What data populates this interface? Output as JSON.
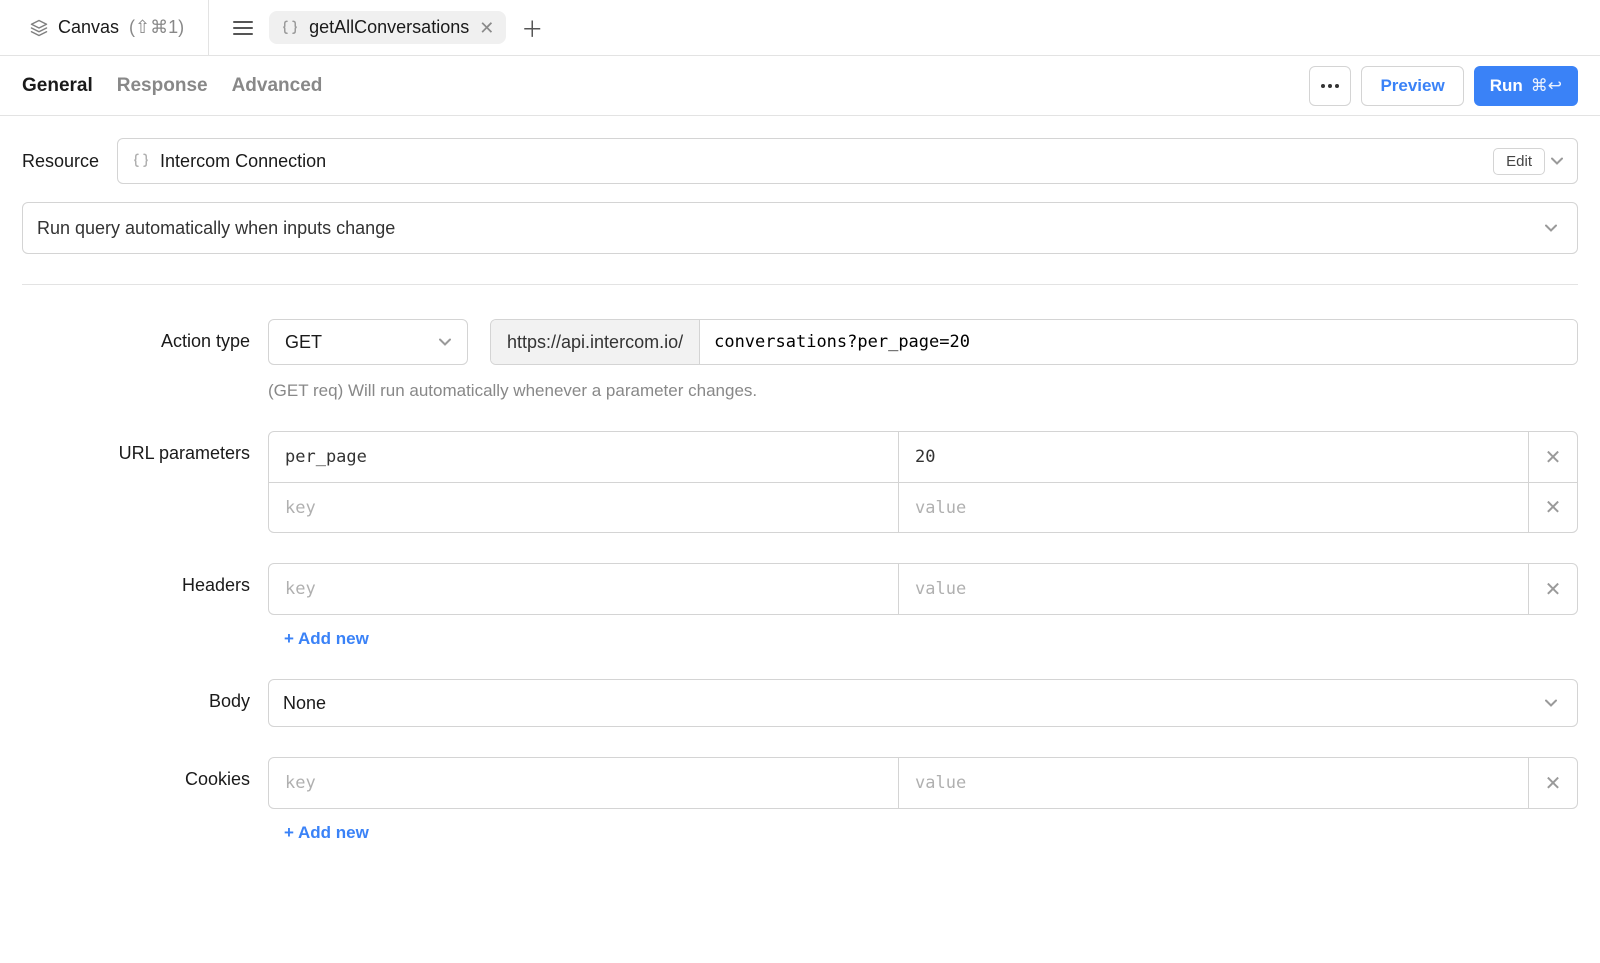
{
  "top": {
    "canvas_label": "Canvas",
    "canvas_shortcut": "(⇧⌘1)",
    "tab_name": "getAllConversations"
  },
  "view_tabs": {
    "general": "General",
    "response": "Response",
    "advanced": "Advanced"
  },
  "actions": {
    "preview": "Preview",
    "run": "Run",
    "run_shortcut": "⌘↩"
  },
  "resource": {
    "label": "Resource",
    "name": "Intercom Connection",
    "edit": "Edit"
  },
  "run_query_option": "Run query automatically when inputs change",
  "section_labels": {
    "action_type": "Action type",
    "url_parameters": "URL parameters",
    "headers": "Headers",
    "body": "Body",
    "cookies": "Cookies"
  },
  "action": {
    "method": "GET",
    "base_url": "https://api.intercom.io/",
    "path": "conversations?per_page=20",
    "hint": "(GET req) Will run automatically whenever a parameter changes."
  },
  "placeholders": {
    "key": "key",
    "value": "value"
  },
  "url_params": [
    {
      "key": "per_page",
      "value": "20"
    }
  ],
  "body_value": "None",
  "add_new": "+ Add new"
}
